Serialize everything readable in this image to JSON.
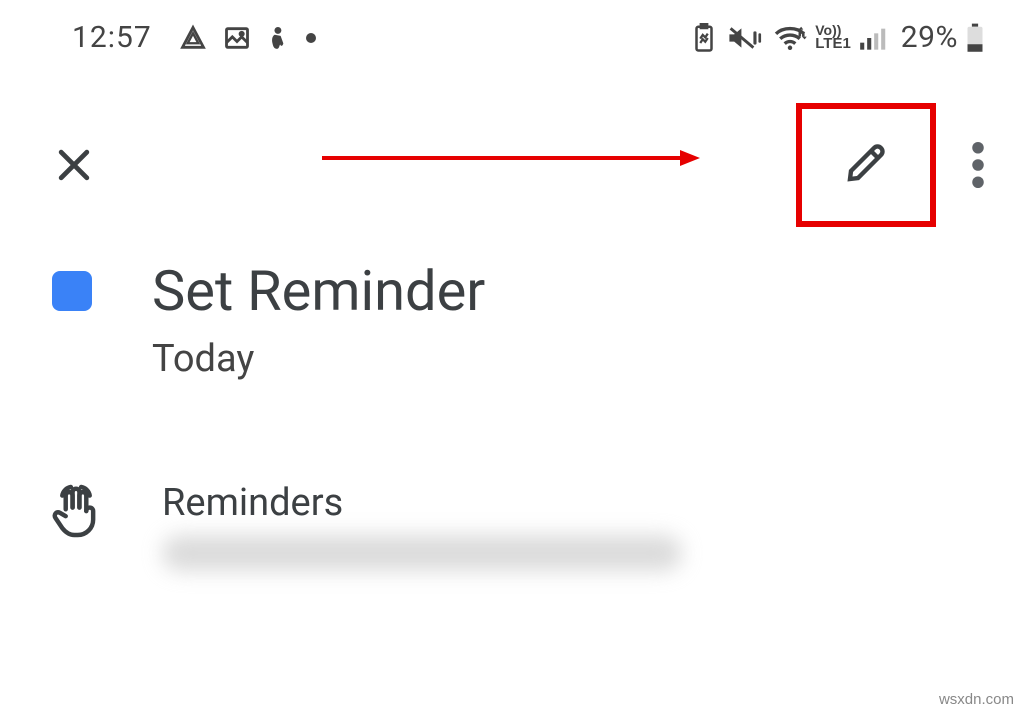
{
  "status_bar": {
    "time": "12:57",
    "battery_percent": "29%",
    "network_label_line1": "Vo))",
    "network_label_line2": "LTE1"
  },
  "toolbar": {
    "close_label": "Close",
    "edit_label": "Edit",
    "more_label": "More options"
  },
  "reminder": {
    "title": "Set Reminder",
    "date_label": "Today",
    "color": "#3a82f7"
  },
  "section": {
    "label": "Reminders",
    "account_blurred": true
  },
  "annotation": {
    "highlight_color": "#e60000",
    "arrow_points_to": "edit-button"
  },
  "watermark": "wsxdn.com"
}
